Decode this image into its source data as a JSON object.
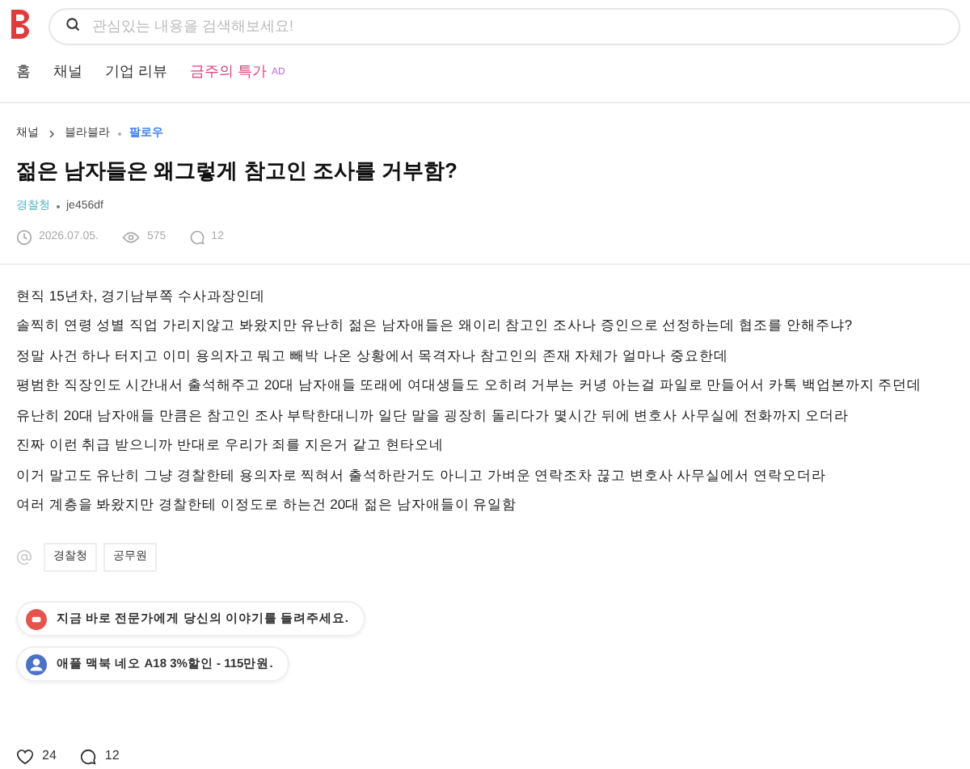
{
  "search": {
    "placeholder": "관심있는 내용을 검색해보세요!"
  },
  "nav": [
    {
      "label": "홈",
      "kind": "plain"
    },
    {
      "label": "채널",
      "kind": "plain"
    },
    {
      "label": "기업 리뷰",
      "kind": "plain"
    },
    {
      "label": "금주의 특가",
      "kind": "promo",
      "badge": "AD"
    }
  ],
  "breadcrumb": {
    "root": "채널",
    "channel": "블라블라",
    "follow": "팔로우"
  },
  "post": {
    "title": "젊은 남자들은 왜그렇게 참고인 조사를 거부함?",
    "company": "경찰청",
    "author": "je456df",
    "date": "2026.07.05.",
    "views": "575",
    "comments": "12",
    "body": [
      "현직 15년차, 경기남부쪽 수사과장인데",
      "솔찍히 연령 성별 직업 가리지않고 봐왔지만 유난히 젊은 남자애들은 왜이리 참고인 조사나 증인으로 선정하는데 협조를 안해주냐?",
      "정말 사건 하나 터지고 이미 용의자고 뭐고 빼박 나온 상황에서 목격자나 참고인의 존재 자체가 얼마나 중요한데",
      "평범한 직장인도 시간내서 출석해주고 20대 남자애들 또래에 여대생들도 오히려 거부는 커녕 아는걸 파일로 만들어서 카톡 백업본까지 주던데",
      "유난히 20대 남자애들 만큼은 참고인 조사 부탁한대니까 일단 말을 굉장히 돌리다가 몇시간 뒤에 변호사 사무실에 전화까지 오더라",
      "진짜 이런 취급 받으니까 반대로 우리가 죄를 지은거 같고 현타오네",
      "이거 말고도 유난히 그냥 경찰한테 용의자로 찍혀서 출석하란거도 아니고 가벼운 연락조차 끊고 변호사 사무실에서 연락오더라",
      "여러 계층을 봐왔지만 경찰한테 이정도로 하는건 20대 젊은 남자애들이 유일함"
    ],
    "tags": [
      "경찰청",
      "공무원"
    ],
    "promos": [
      {
        "text": "지금 바로 전문가에게 당신의 이야기를 들려주세요.",
        "kind": "expert",
        "color": "#e5534b"
      },
      {
        "text": "애플 맥북 네오 A18 3%할인 - 115만원.",
        "kind": "person",
        "color": "#4a72c8"
      }
    ],
    "likes": "24",
    "comment_count": "12"
  }
}
